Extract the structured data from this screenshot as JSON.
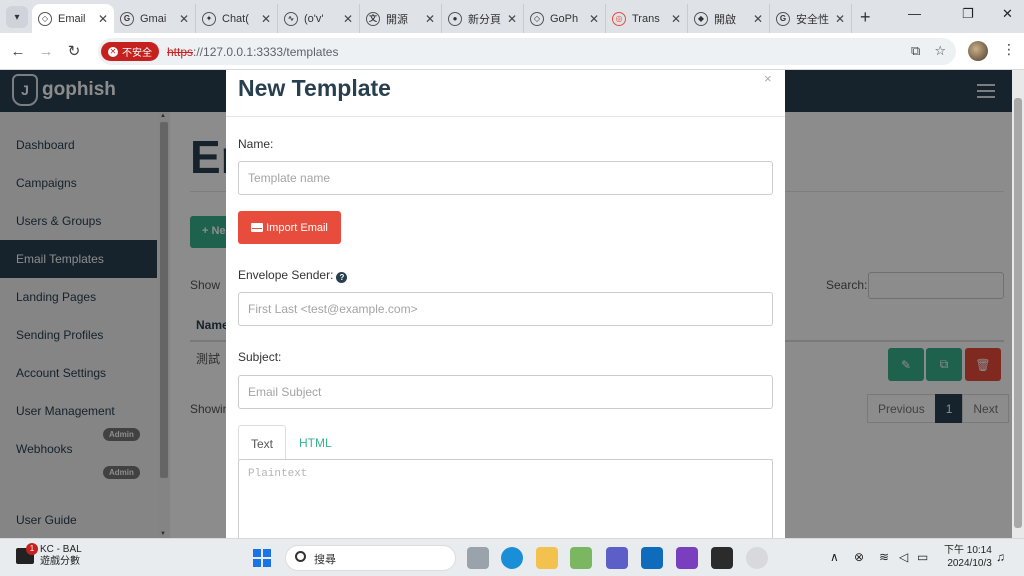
{
  "browser": {
    "tabs": [
      {
        "label": "Email",
        "icon": "gophish-icon",
        "active": true
      },
      {
        "label": "Gmai",
        "icon": "google-icon"
      },
      {
        "label": "Chat(",
        "icon": "chatgpt-icon"
      },
      {
        "label": "(o'v'",
        "icon": "site-icon"
      },
      {
        "label": "開源",
        "icon": "translate-icon"
      },
      {
        "label": "新分頁",
        "icon": "chrome-icon"
      },
      {
        "label": "GoPh",
        "icon": "gophish-icon"
      },
      {
        "label": "Trans",
        "icon": "translate-icon"
      },
      {
        "label": "開啟",
        "icon": "site-icon"
      },
      {
        "label": "安全性",
        "icon": "google-icon"
      }
    ],
    "new_tab": "+",
    "security_label": "不安全",
    "url_scheme": "https",
    "url_rest": "://127.0.0.1:3333/templates"
  },
  "app": {
    "brand": "gophish",
    "sidebar": {
      "items": [
        {
          "label": "Dashboard"
        },
        {
          "label": "Campaigns"
        },
        {
          "label": "Users & Groups"
        },
        {
          "label": "Email Templates",
          "active": true
        },
        {
          "label": "Landing Pages"
        },
        {
          "label": "Sending Profiles"
        },
        {
          "label": "Account Settings"
        },
        {
          "label": "User Management"
        },
        {
          "label": "Webhooks"
        },
        {
          "label": "User Guide"
        }
      ],
      "admin_badge": "Admin"
    },
    "page": {
      "title_partial": "Em",
      "new_button": "+ Ne",
      "show_label": "Show",
      "search_label": "Search:",
      "column_name": "Name",
      "row_name": "測試",
      "showing_partial": "Showin",
      "pager": [
        "Previous",
        "1",
        "Next"
      ]
    }
  },
  "modal": {
    "title": "New Template",
    "close": "×",
    "name_label": "Name:",
    "name_placeholder": "Template name",
    "import_button": "Import Email",
    "envelope_label": "Envelope Sender:",
    "envelope_placeholder": "First Last <test@example.com>",
    "subject_label": "Subject:",
    "subject_placeholder": "Email Subject",
    "tabs": [
      "Text",
      "HTML"
    ],
    "text_placeholder": "Plaintext"
  },
  "taskbar": {
    "weather_title": "KC - BAL",
    "weather_sub": "遊戲分數",
    "notification_count": "1",
    "search_label": "搜尋",
    "time": "下午 10:14",
    "date": "2024/10/3"
  },
  "colors": {
    "navy": "#283f50",
    "green": "#37b38f",
    "red": "#e74c3c"
  }
}
